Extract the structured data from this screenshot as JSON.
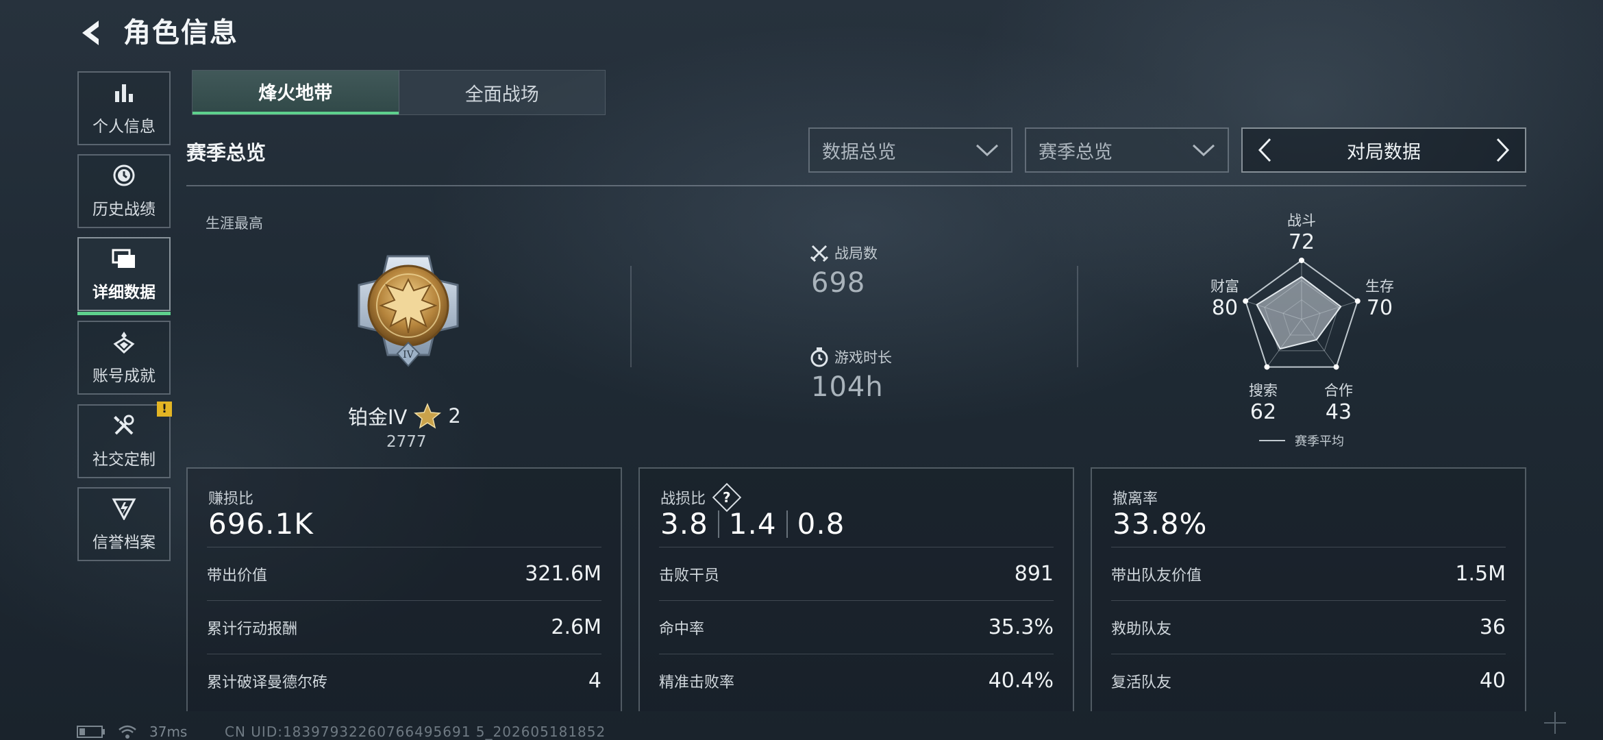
{
  "header": {
    "title": "角色信息"
  },
  "sidebar": {
    "items": [
      {
        "label": "个人信息",
        "icon": "bar-chart-icon"
      },
      {
        "label": "历史战绩",
        "icon": "clock-icon"
      },
      {
        "label": "详细数据",
        "icon": "folders-icon",
        "active": true
      },
      {
        "label": "账号成就",
        "icon": "medal-icon"
      },
      {
        "label": "社交定制",
        "icon": "tools-icon",
        "badge": "!"
      },
      {
        "label": "信誉档案",
        "icon": "shield-icon"
      }
    ]
  },
  "tabs": [
    {
      "label": "烽火地带",
      "active": true
    },
    {
      "label": "全面战场",
      "active": false
    }
  ],
  "section_title": "赛季总览",
  "filters": {
    "dropdown1": "数据总览",
    "dropdown2": "赛季总览",
    "pager": "对局数据"
  },
  "career": {
    "label": "生涯最高",
    "rank": "铂金IV",
    "stars": "2",
    "score": "2777",
    "emblem_numeral": "IV"
  },
  "summary": {
    "matches_label": "战局数",
    "matches_value": "698",
    "playtime_label": "游戏时长",
    "playtime_value": "104h"
  },
  "radar": {
    "legend": "赛季平均",
    "axes": [
      {
        "label": "战斗",
        "value": 72
      },
      {
        "label": "生存",
        "value": 70
      },
      {
        "label": "合作",
        "value": 43
      },
      {
        "label": "搜索",
        "value": 62
      },
      {
        "label": "财富",
        "value": 80
      }
    ]
  },
  "cards": {
    "profit": {
      "label": "赚损比",
      "value": "696.1K",
      "rows": [
        {
          "label": "带出价值",
          "value": "321.6M"
        },
        {
          "label": "累计行动报酬",
          "value": "2.6M"
        },
        {
          "label": "累计破译曼德尔砖",
          "value": "4"
        }
      ]
    },
    "kd": {
      "label": "战损比",
      "help": "?",
      "values": [
        "3.8",
        "1.4",
        "0.8"
      ],
      "rows": [
        {
          "label": "击败干员",
          "value": "891"
        },
        {
          "label": "命中率",
          "value": "35.3%"
        },
        {
          "label": "精准击败率",
          "value": "40.4%"
        }
      ]
    },
    "extract": {
      "label": "撤离率",
      "value": "33.8%",
      "rows": [
        {
          "label": "带出队友价值",
          "value": "1.5M"
        },
        {
          "label": "救助队友",
          "value": "36"
        },
        {
          "label": "复活队友",
          "value": "40"
        }
      ]
    }
  },
  "footer": {
    "ping": "37ms",
    "uid": "CN UID:18397932260766495691 5_202605181852"
  },
  "colors": {
    "accent": "#5ed18d",
    "badge": "#e3b524"
  }
}
